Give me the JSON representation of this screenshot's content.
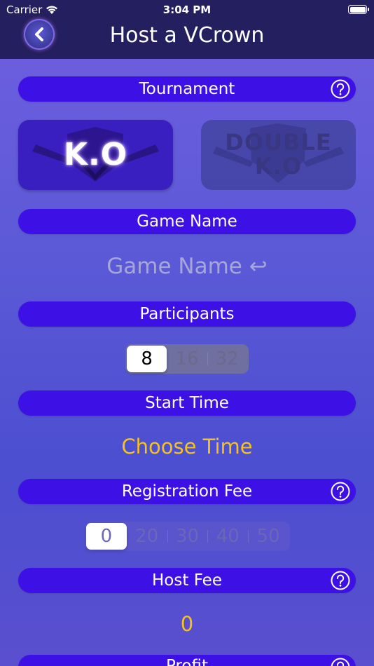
{
  "status_bar": {
    "carrier": "Carrier",
    "time": "3:04 PM"
  },
  "nav": {
    "title": "Host a VCrown",
    "back_icon": "chevron-left-icon"
  },
  "sections": {
    "tournament": "Tournament",
    "game_name": "Game Name",
    "participants": "Participants",
    "start_time": "Start Time",
    "registration_fee": "Registration Fee",
    "host_fee": "Host Fee",
    "profit": "Profit"
  },
  "tournament_modes": [
    {
      "label": "K.O",
      "selected": true
    },
    {
      "label_line1": "DOUBLE",
      "label_line2": "K.O",
      "selected": false
    }
  ],
  "game_name_input": {
    "placeholder": "Game Name ↩"
  },
  "participants_options": [
    "8",
    "16",
    "32"
  ],
  "participants_selected": "8",
  "start_time_value": "Choose Time",
  "registration_fee_options": [
    "0",
    "20",
    "30",
    "40",
    "50"
  ],
  "registration_fee_selected": "0",
  "host_fee_value": "0",
  "colors": {
    "nav_background": "#241f5e",
    "section_bar": "#3d10e6",
    "accent_yellow": "#f5c11b"
  }
}
